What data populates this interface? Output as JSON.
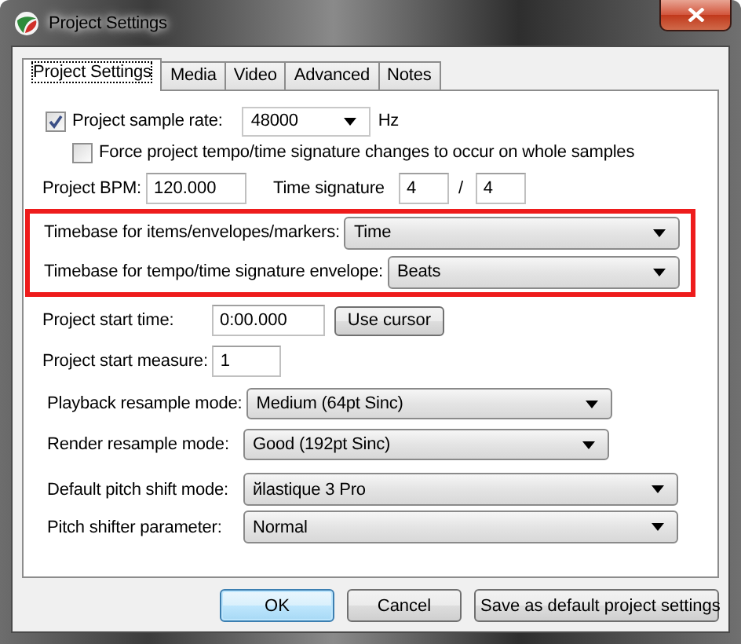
{
  "window": {
    "title": "Project Settings"
  },
  "tabs": [
    {
      "label": "Project Settings",
      "selected": true
    },
    {
      "label": "Media",
      "selected": false
    },
    {
      "label": "Video",
      "selected": false
    },
    {
      "label": "Advanced",
      "selected": false
    },
    {
      "label": "Notes",
      "selected": false
    }
  ],
  "sample_rate": {
    "label": "Project sample rate:",
    "checked": true,
    "value": "48000",
    "unit": "Hz"
  },
  "force_whole_samples": {
    "label": "Force project tempo/time signature changes to occur on whole samples",
    "checked": false
  },
  "bpm": {
    "label": "Project BPM:",
    "value": "120.000"
  },
  "time_signature": {
    "label": "Time signature",
    "numerator": "4",
    "separator": "/",
    "denominator": "4"
  },
  "timebase": [
    {
      "label": "Timebase for items/envelopes/markers:",
      "value": "Time"
    },
    {
      "label": "Timebase for tempo/time signature envelope:",
      "value": "Beats"
    }
  ],
  "start_time": {
    "label": "Project start time:",
    "value": "0:00.000",
    "button": "Use cursor"
  },
  "start_measure": {
    "label": "Project start measure:",
    "value": "1"
  },
  "resample": [
    {
      "label": "Playback resample mode:",
      "value": "Medium (64pt Sinc)"
    },
    {
      "label": "Render resample mode:",
      "value": "Good (192pt Sinc)"
    }
  ],
  "pitch": [
    {
      "label": "Default pitch shift mode:",
      "value": "йlastique 3 Pro"
    },
    {
      "label": "Pitch shifter parameter:",
      "value": "Normal"
    }
  ],
  "buttons": [
    {
      "label": "OK",
      "default": true
    },
    {
      "label": "Cancel",
      "default": false
    },
    {
      "label": "Save as default project settings",
      "default": false
    }
  ]
}
